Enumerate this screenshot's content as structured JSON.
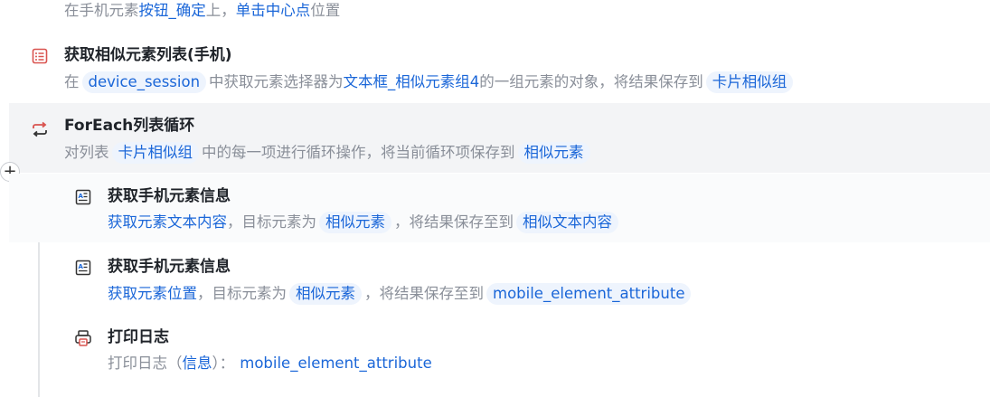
{
  "steps": {
    "click": {
      "desc": [
        "在手机元素",
        "按钮_确定",
        "上，",
        "单击中心点",
        "位置"
      ]
    },
    "get_similar": {
      "title": "获取相似元素列表(手机)",
      "desc": [
        "在",
        "device_session",
        "中获取元素选择器为",
        "文本框_相似元素组4",
        "的一组元素的对象，将结果保存到",
        "卡片相似组"
      ]
    },
    "foreach": {
      "title": "ForEach列表循环",
      "desc": [
        "对列表",
        "卡片相似组",
        "中的每一项进行循环操作，将当前循环项保存到",
        "相似元素"
      ]
    },
    "get_info_1": {
      "title": "获取手机元素信息",
      "desc": [
        "获取元素文本内容",
        "，目标元素为",
        "相似元素",
        "，将结果保存至到",
        "相似文本内容"
      ]
    },
    "get_info_2": {
      "title": "获取手机元素信息",
      "desc": [
        "获取元素位置",
        "，目标元素为",
        "相似元素",
        "，将结果保存至到",
        "mobile_element_attribute"
      ]
    },
    "print_log": {
      "title": "打印日志",
      "desc": [
        "打印日志（",
        "信息",
        "）：",
        "mobile_element_attribute"
      ]
    }
  },
  "add_button": {
    "label": "+"
  },
  "icons": {
    "list": "list-icon",
    "loop": "loop-icon",
    "element_info": "element-info-icon",
    "printer": "printer-icon"
  },
  "colors": {
    "accent": "#1a66d8",
    "chip_bg": "#eef4fd",
    "loop_icon": "#d9534f",
    "hover_bg": "#f3f4f6"
  }
}
